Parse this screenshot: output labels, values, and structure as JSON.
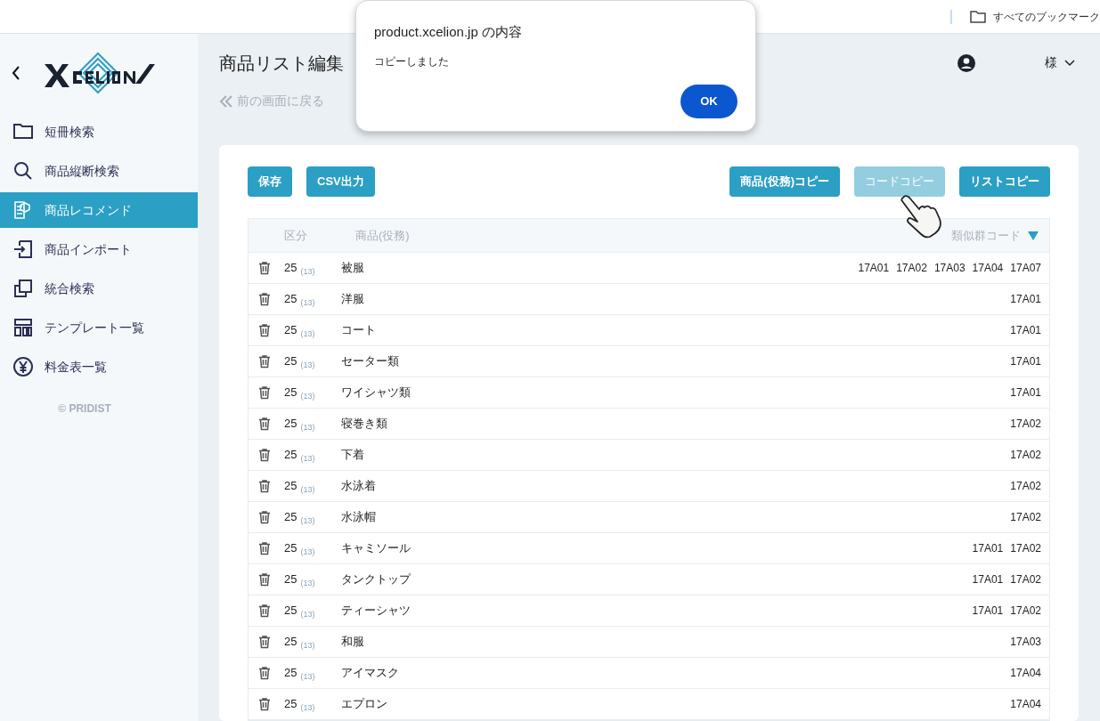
{
  "browser_bar": {
    "bookmarks": "すべてのブックマーク"
  },
  "sidebar": {
    "items": [
      {
        "label": "短冊検索",
        "selected": false
      },
      {
        "label": "商品縦断検索",
        "selected": false
      },
      {
        "label": "商品レコメンド",
        "selected": true
      },
      {
        "label": "商品インポート",
        "selected": false
      },
      {
        "label": "統合検索",
        "selected": false
      },
      {
        "label": "テンプレート一覧",
        "selected": false
      },
      {
        "label": "料金表一覧",
        "selected": false
      }
    ],
    "copyright": "© PRIDIST"
  },
  "header": {
    "title": "商品リスト編集",
    "back_link": "前の画面に戻る",
    "user": "様"
  },
  "toolbar": {
    "left_buttons": [
      {
        "label": "保存",
        "disabled": false
      },
      {
        "label": "CSV出力",
        "disabled": false
      }
    ],
    "right_buttons": [
      {
        "label": "商品(役務)コピー",
        "disabled": false
      },
      {
        "label": "コードコピー",
        "disabled": true
      },
      {
        "label": "リストコピー",
        "disabled": false
      }
    ]
  },
  "table": {
    "columns": [
      "区分",
      "商品(役務)",
      "類似群コード"
    ],
    "rows": [
      {
        "class": "25",
        "sub": "(13)",
        "item": "被服",
        "codes": [
          "17A01",
          "17A02",
          "17A03",
          "17A04",
          "17A07"
        ]
      },
      {
        "class": "25",
        "sub": "(13)",
        "item": "洋服",
        "codes": [
          "17A01"
        ]
      },
      {
        "class": "25",
        "sub": "(13)",
        "item": "コート",
        "codes": [
          "17A01"
        ]
      },
      {
        "class": "25",
        "sub": "(13)",
        "item": "セーター類",
        "codes": [
          "17A01"
        ]
      },
      {
        "class": "25",
        "sub": "(13)",
        "item": "ワイシャツ類",
        "codes": [
          "17A01"
        ]
      },
      {
        "class": "25",
        "sub": "(13)",
        "item": "寝巻き類",
        "codes": [
          "17A02"
        ]
      },
      {
        "class": "25",
        "sub": "(13)",
        "item": "下着",
        "codes": [
          "17A02"
        ]
      },
      {
        "class": "25",
        "sub": "(13)",
        "item": "水泳着",
        "codes": [
          "17A02"
        ]
      },
      {
        "class": "25",
        "sub": "(13)",
        "item": "水泳帽",
        "codes": [
          "17A02"
        ]
      },
      {
        "class": "25",
        "sub": "(13)",
        "item": "キャミソール",
        "codes": [
          "17A01",
          "17A02"
        ]
      },
      {
        "class": "25",
        "sub": "(13)",
        "item": "タンクトップ",
        "codes": [
          "17A01",
          "17A02"
        ]
      },
      {
        "class": "25",
        "sub": "(13)",
        "item": "ティーシャツ",
        "codes": [
          "17A01",
          "17A02"
        ]
      },
      {
        "class": "25",
        "sub": "(13)",
        "item": "和服",
        "codes": [
          "17A03"
        ]
      },
      {
        "class": "25",
        "sub": "(13)",
        "item": "アイマスク",
        "codes": [
          "17A04"
        ]
      },
      {
        "class": "25",
        "sub": "(13)",
        "item": "エプロン",
        "codes": [
          "17A04"
        ]
      }
    ]
  },
  "dialog": {
    "title": "product.xcelion.jp の内容",
    "message": "コピーしました",
    "button": "OK"
  }
}
